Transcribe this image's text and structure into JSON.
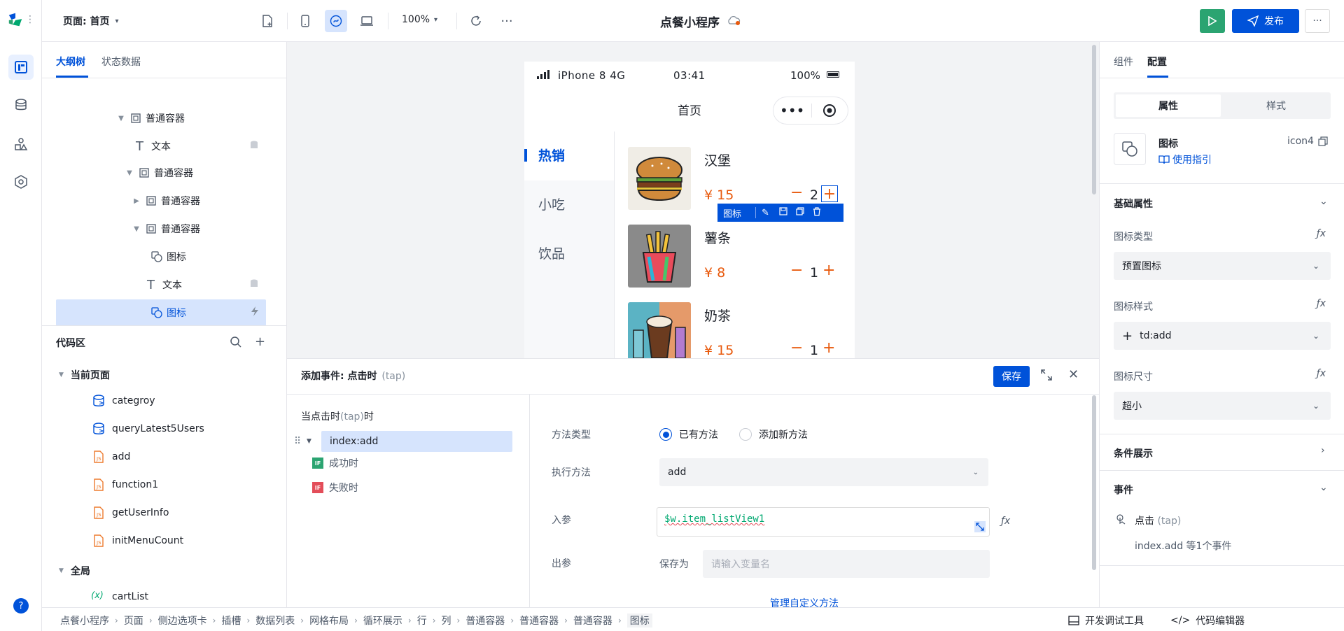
{
  "topbar": {
    "page_label": "页面: 首页",
    "zoom": "100%",
    "app_title": "点餐小程序",
    "publish_label": "发布"
  },
  "left": {
    "tabs": [
      "大纲树",
      "状态数据"
    ],
    "tree": [
      {
        "label": "普通容器",
        "depth": 0
      },
      {
        "label": "文本",
        "depth": 1
      },
      {
        "label": "普通容器",
        "depth": 1
      },
      {
        "label": "普通容器",
        "depth": 2
      },
      {
        "label": "普通容器",
        "depth": 2
      },
      {
        "label": "图标",
        "depth": 3
      },
      {
        "label": "文本",
        "depth": 3
      },
      {
        "label": "图标",
        "depth": 3
      }
    ],
    "code_title": "代码区",
    "current_page": "当前页面",
    "code_items": [
      "categroy",
      "queryLatest5Users",
      "add",
      "function1",
      "getUserInfo",
      "initMenuCount"
    ],
    "global": "全局",
    "global_items": [
      "cartList"
    ]
  },
  "phone": {
    "status": {
      "carrier": "iPhone 8  4G",
      "time": "03:41",
      "battery": "100%"
    },
    "nav_title": "首页",
    "categories": [
      "热销",
      "小吃",
      "饮品"
    ],
    "products": [
      {
        "name": "汉堡",
        "price": "¥ 15",
        "qty": "2"
      },
      {
        "name": "薯条",
        "price": "¥ 8",
        "qty": "1"
      },
      {
        "name": "奶茶",
        "price": "¥ 15",
        "qty": "1"
      }
    ],
    "selection_label": "图标"
  },
  "right": {
    "tabs": [
      "组件",
      "配置"
    ],
    "seg": [
      "属性",
      "样式"
    ],
    "comp_name": "图标",
    "comp_id": "icon4",
    "guide": "使用指引",
    "basic": "基础属性",
    "icon_type_label": "图标类型",
    "icon_type_value": "预置图标",
    "icon_style_label": "图标样式",
    "icon_style_value": "td:add",
    "icon_size_label": "图标尺寸",
    "icon_size_value": "超小",
    "condition": "条件展示",
    "event": "事件",
    "event_tap": "点击",
    "event_tap_en": "(tap)",
    "event_summary": "index.add 等1个事件"
  },
  "event_panel": {
    "title": "添加事件: 点击时",
    "title_en": "(tap)",
    "save": "保存",
    "trigger_prefix": "当点击时",
    "trigger_en": "(tap)",
    "trigger_suffix": "时",
    "action": "index:add",
    "success": "成功时",
    "fail": "失败时",
    "method_type_label": "方法类型",
    "method_existing": "已有方法",
    "method_new": "添加新方法",
    "exec_label": "执行方法",
    "exec_value": "add",
    "param_label": "入参",
    "param_value": "$w.item_listView1",
    "out_label": "出参",
    "save_as": "保存为",
    "save_as_placeholder": "请输入变量名",
    "manage": "管理自定义方法"
  },
  "bottom": {
    "crumbs": [
      "点餐小程序",
      "页面",
      "侧边选项卡",
      "插槽",
      "数据列表",
      "网格布局",
      "循环展示",
      "行",
      "列",
      "普通容器",
      "普通容器",
      "普通容器",
      "图标"
    ],
    "dev_tools": "开发调试工具",
    "code_editor": "代码编辑器"
  },
  "colors": {
    "primary": "#0052d9",
    "accent_orange": "#e8590c",
    "green": "#00a870"
  }
}
